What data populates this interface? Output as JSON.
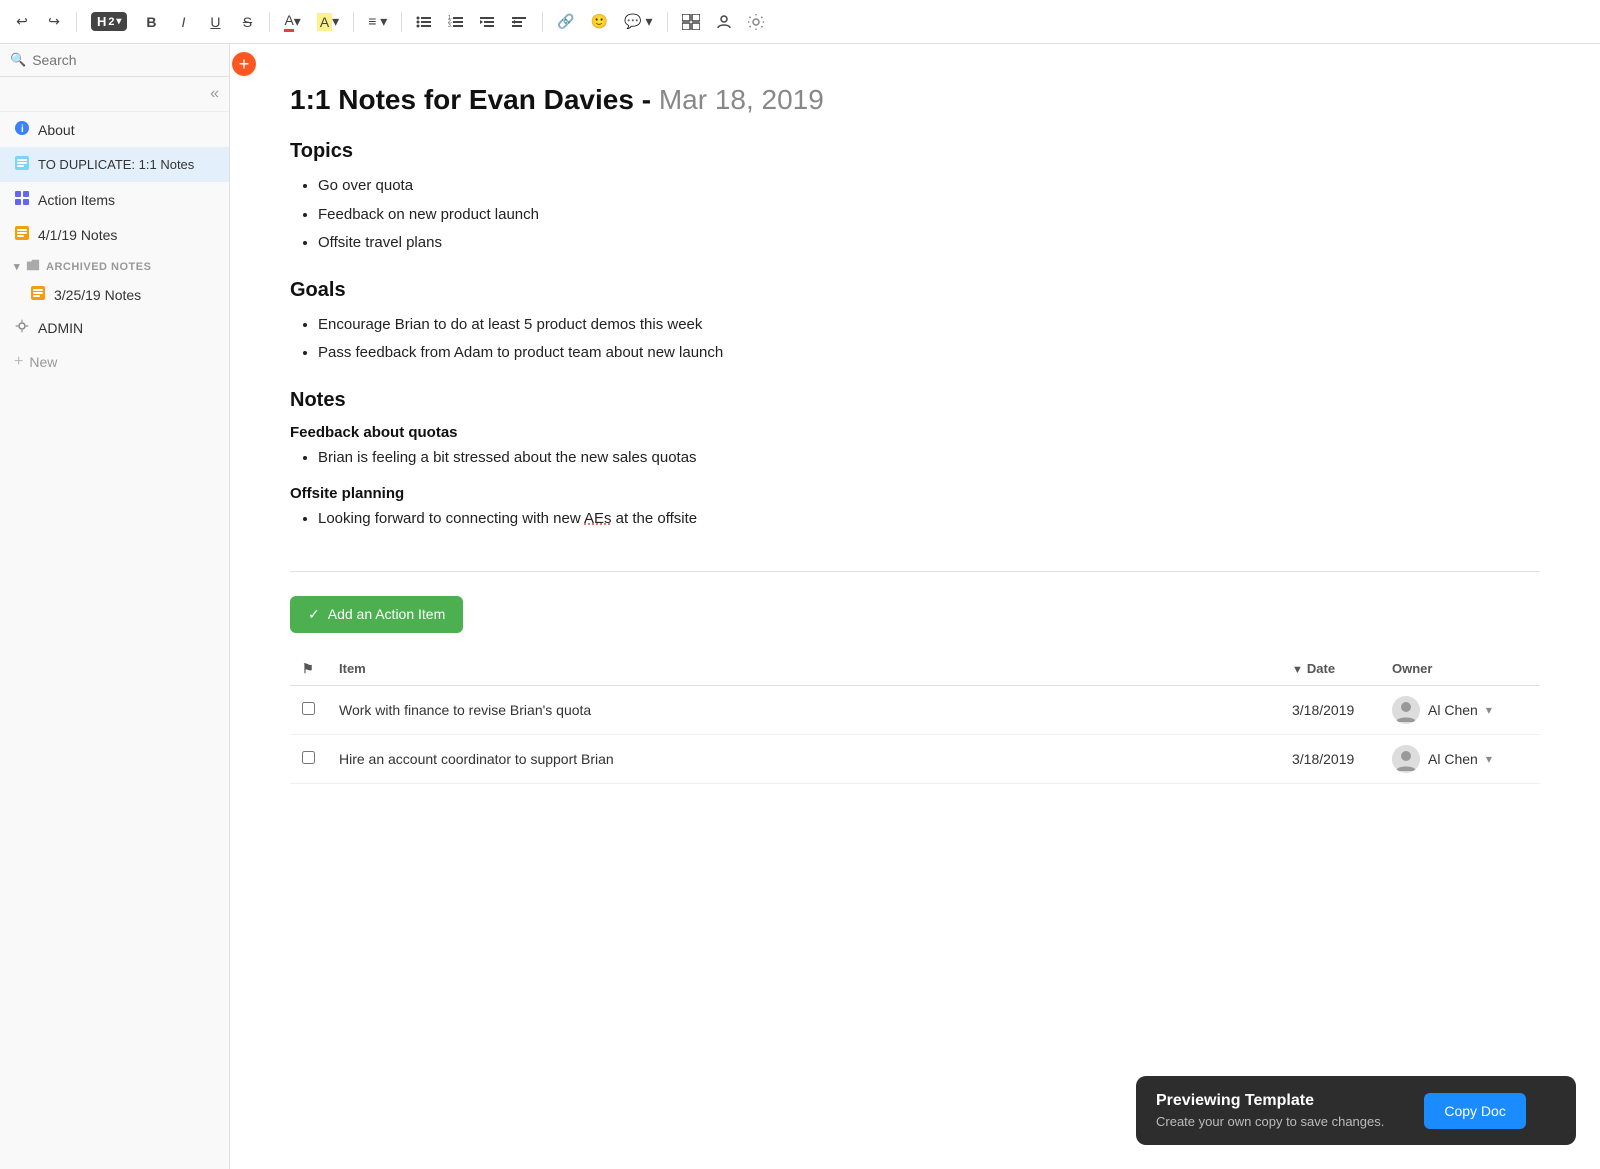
{
  "toolbar": {
    "heading_label": "H",
    "heading_sub": "2",
    "bold": "B",
    "italic": "I",
    "underline": "U",
    "strikethrough": "S",
    "undo": "↩",
    "redo": "↪",
    "font_color_label": "A",
    "highlight_label": "A",
    "align_label": "≡",
    "bullet_list": "≡",
    "ordered_list": "≡",
    "indent_in": "→",
    "indent_out": "←",
    "link": "🔗",
    "emoji": "😊",
    "comment": "💬",
    "more": "...",
    "table": "⊞",
    "person": "☺",
    "settings": "✦"
  },
  "sidebar": {
    "search_placeholder": "Search",
    "plus_label": "+",
    "items": [
      {
        "id": "about",
        "label": "About",
        "icon": "info-icon"
      },
      {
        "id": "to-duplicate",
        "label": "TO DUPLICATE: 1:1 Notes",
        "icon": "doc-icon",
        "active": true
      },
      {
        "id": "action-items",
        "label": "Action Items",
        "icon": "grid-icon"
      },
      {
        "id": "notes-4-1",
        "label": "4/1/19 Notes",
        "icon": "note-icon"
      }
    ],
    "archived_section_label": "ARCHIVED NOTES",
    "archived_items": [
      {
        "id": "notes-3-25",
        "label": "3/25/19 Notes",
        "icon": "note-icon"
      }
    ],
    "admin_label": "ADMIN",
    "new_label": "New"
  },
  "document": {
    "title": "1:1 Notes for Evan Davies -",
    "date": "Mar 18, 2019",
    "sections": [
      {
        "heading": "Topics",
        "type": "list",
        "items": [
          "Go over quota",
          "Feedback on new product launch",
          "Offsite travel plans"
        ]
      },
      {
        "heading": "Goals",
        "type": "list",
        "items": [
          "Encourage Brian to do at least 5 product demos this week",
          "Pass feedback from Adam to product team about new launch"
        ]
      },
      {
        "heading": "Notes",
        "type": "subsections",
        "subsections": [
          {
            "label": "Feedback about quotas",
            "items": [
              "Brian is feeling a bit stressed about the new sales quotas"
            ]
          },
          {
            "label": "Offsite planning",
            "items_with_special": [
              {
                "text_before": "Looking forward to connecting with new ",
                "special": "AEs",
                "text_after": " at the offsite"
              }
            ]
          }
        ]
      }
    ]
  },
  "action_items": {
    "add_button_label": "Add an Action Item",
    "table_headers": {
      "checkbox": "",
      "item": "Item",
      "date": "Date",
      "owner": "Owner"
    },
    "rows": [
      {
        "item": "Work with finance to revise Brian's quota",
        "date": "3/18/2019",
        "owner": "Al Chen"
      },
      {
        "item": "Hire an account coordinator to support Brian",
        "date": "3/18/2019",
        "owner": "Al Chen"
      }
    ]
  },
  "preview_banner": {
    "title": "Previewing Template",
    "subtitle": "Create your own copy to save changes.",
    "button_label": "Copy Doc"
  }
}
